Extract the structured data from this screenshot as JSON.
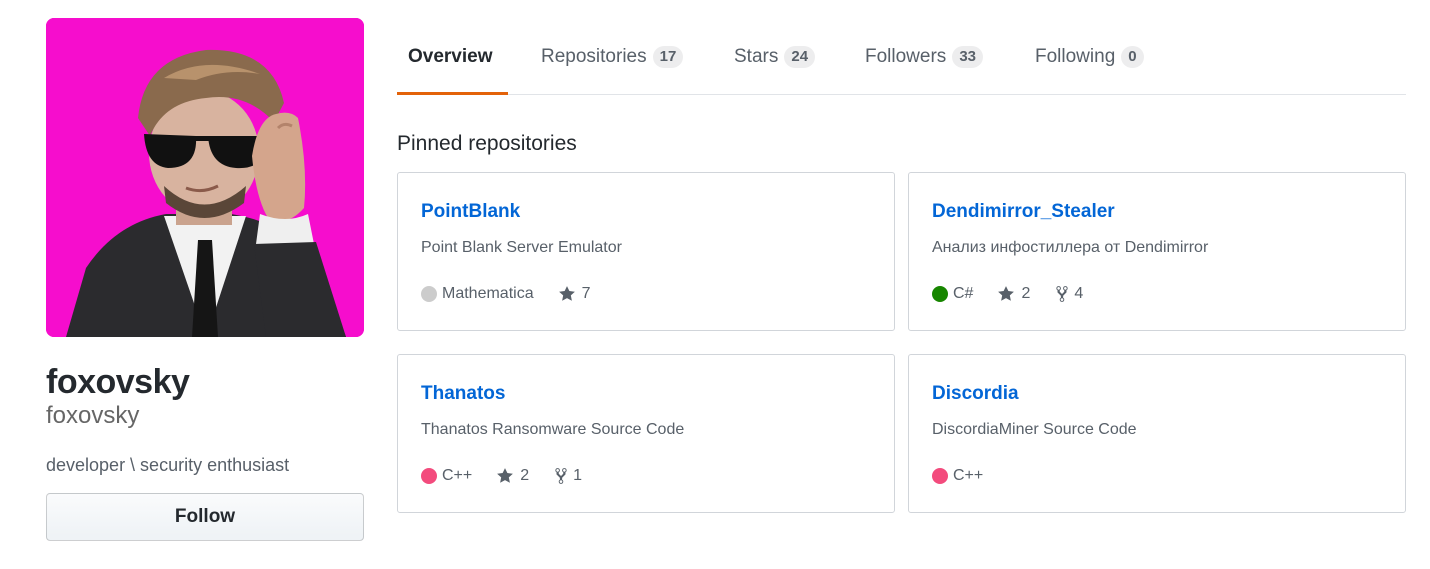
{
  "profile": {
    "fullname": "foxovsky",
    "login": "foxovsky",
    "bio": "developer \\ security enthusiast",
    "follow_label": "Follow",
    "avatar_background": "#f60dcd"
  },
  "tabs": [
    {
      "label": "Overview",
      "count": null,
      "selected": true
    },
    {
      "label": "Repositories",
      "count": "17"
    },
    {
      "label": "Stars",
      "count": "24"
    },
    {
      "label": "Followers",
      "count": "33"
    },
    {
      "label": "Following",
      "count": "0"
    }
  ],
  "pinned": {
    "title": "Pinned repositories",
    "repos": [
      {
        "name": "PointBlank",
        "description": "Point Blank Server Emulator",
        "language": "Mathematica",
        "lang_color": "#cccccc",
        "stars": "7",
        "forks": null
      },
      {
        "name": "Dendimirror_Stealer",
        "description": "Анализ инфостиллера от Dendimirror",
        "language": "C#",
        "lang_color": "#178600",
        "stars": "2",
        "forks": "4"
      },
      {
        "name": "Thanatos",
        "description": "Thanatos Ransomware Source Code",
        "language": "C++",
        "lang_color": "#f34b7d",
        "stars": "2",
        "forks": "1"
      },
      {
        "name": "Discordia",
        "description": "DiscordiaMiner Source Code",
        "language": "C++",
        "lang_color": "#f34b7d",
        "stars": null,
        "forks": null
      }
    ]
  },
  "icons": {
    "star": "star-icon",
    "fork": "fork-icon"
  },
  "colors": {
    "accent_underline": "#e36209",
    "link": "#0366d6"
  }
}
